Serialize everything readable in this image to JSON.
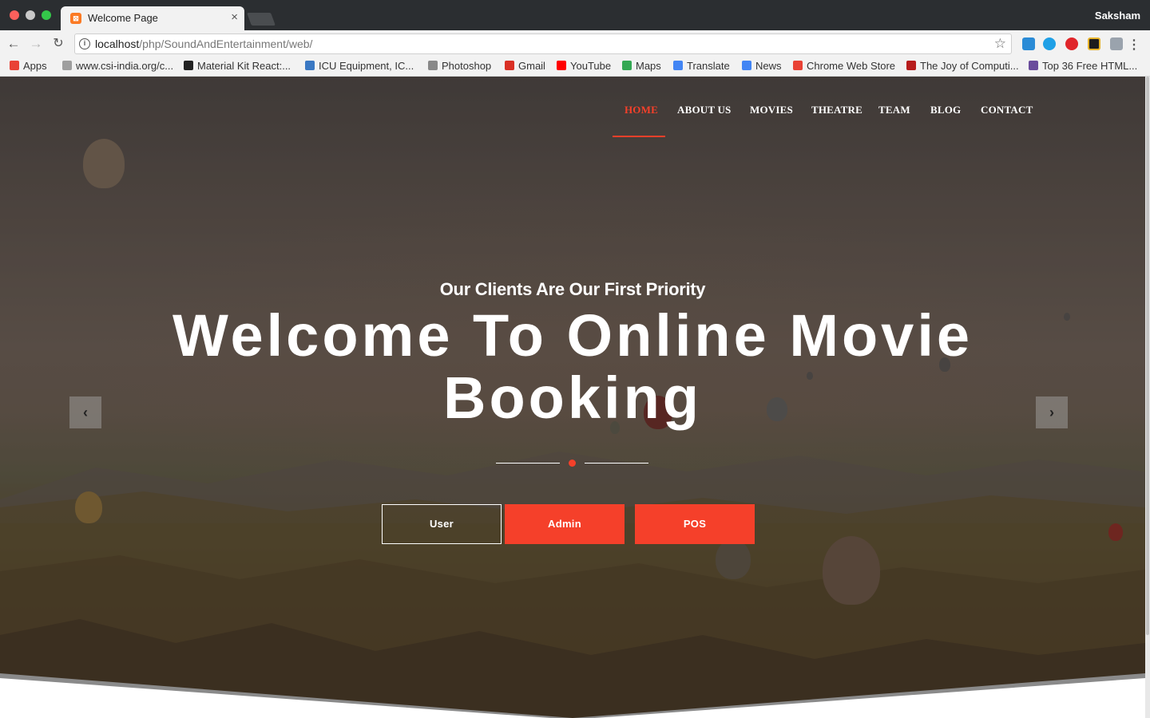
{
  "browser": {
    "tab_title": "Welcome Page",
    "profile_name": "Saksham",
    "url_host": "localhost",
    "url_path": "/php/SoundAndEntertainment/web/",
    "bookmarks": [
      {
        "label": "Apps",
        "color": "#e94235"
      },
      {
        "label": "www.csi-india.org/c...",
        "color": "#9e9e9e"
      },
      {
        "label": "Material Kit React:...",
        "color": "#222222"
      },
      {
        "label": "ICU Equipment, IC...",
        "color": "#3a78c3"
      },
      {
        "label": "Photoshop",
        "color": "#888888"
      },
      {
        "label": "Gmail",
        "color": "#d93025"
      },
      {
        "label": "YouTube",
        "color": "#ff0000"
      },
      {
        "label": "Maps",
        "color": "#34a853"
      },
      {
        "label": "Translate",
        "color": "#4285f4"
      },
      {
        "label": "News",
        "color": "#4285f4"
      },
      {
        "label": "Chrome Web Store",
        "color": "#e94235"
      },
      {
        "label": "The Joy of Computi...",
        "color": "#b71c1c"
      },
      {
        "label": "Top 36 Free HTML...",
        "color": "#6a4c9c"
      }
    ]
  },
  "nav": {
    "items": [
      "HOME",
      "ABOUT US",
      "MOVIES",
      "THEATRE",
      "TEAM",
      "BLOG",
      "CONTACT"
    ],
    "active": "HOME"
  },
  "hero": {
    "subheadline": "Our Clients Are Our First Priority",
    "headline_line1": "Welcome To Online Movie",
    "headline_line2": "Booking",
    "buttons": {
      "user": "User",
      "admin": "Admin",
      "pos": "POS"
    },
    "prev_icon": "‹",
    "next_icon": "›"
  },
  "colors": {
    "accent": "#f5402a",
    "chrome_dark": "#2b2e31",
    "chrome_light": "#f2f2f2"
  }
}
